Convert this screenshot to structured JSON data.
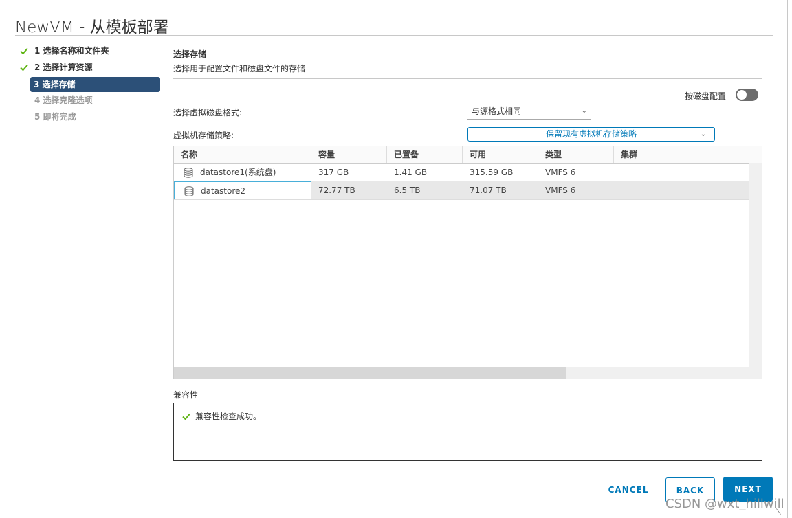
{
  "window": {
    "title": "NewVM - 从模板部署"
  },
  "steps": [
    {
      "label": "1 选择名称和文件夹",
      "state": "done"
    },
    {
      "label": "2 选择计算资源",
      "state": "done"
    },
    {
      "label": "3 选择存储",
      "state": "active"
    },
    {
      "label": "4 选择克隆选项",
      "state": "pending"
    },
    {
      "label": "5 即将完成",
      "state": "pending"
    }
  ],
  "section": {
    "title": "选择存储",
    "subtitle": "选择用于配置文件和磁盘文件的存储"
  },
  "toggle": {
    "label": "按磁盘配置",
    "on": false
  },
  "disk_format": {
    "label": "选择虚拟磁盘格式:",
    "value": "与源格式相同"
  },
  "storage_policy": {
    "label": "虚拟机存储策略:",
    "value": "保留现有虚拟机存储策略"
  },
  "table": {
    "columns": [
      "名称",
      "容量",
      "已置备",
      "可用",
      "类型",
      "集群"
    ],
    "rows": [
      {
        "name": "datastore1(系统盘)",
        "capacity": "317 GB",
        "provisioned": "1.41 GB",
        "free": "315.59 GB",
        "type": "VMFS 6",
        "cluster": ""
      },
      {
        "name": "datastore2",
        "capacity": "72.77 TB",
        "provisioned": "6.5 TB",
        "free": "71.07 TB",
        "type": "VMFS 6",
        "cluster": "",
        "selected": true
      }
    ]
  },
  "compatibility": {
    "title": "兼容性",
    "message": "兼容性检查成功。"
  },
  "buttons": {
    "cancel": "CANCEL",
    "back": "BACK",
    "next": "NEXT"
  },
  "watermark": "CSDN @wxt_hillwill",
  "colors": {
    "accent": "#0079b8",
    "active_step": "#2c5078",
    "success": "#60b515"
  }
}
